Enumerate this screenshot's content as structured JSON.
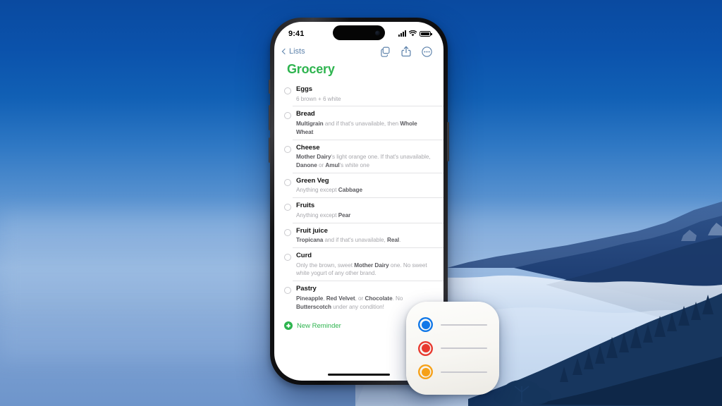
{
  "wallpaper": {
    "description": "Big Sur coastal mountains above a sea of fog, blue sky",
    "sky_top_color": "#0a4da0",
    "sky_bottom_color": "#7ba0d2"
  },
  "phone": {
    "status_bar": {
      "time": "9:41",
      "cellular_icon": "cellular-bars-icon",
      "wifi_icon": "wifi-icon",
      "battery_icon": "battery-full-icon"
    },
    "nav": {
      "back_label": "Lists",
      "back_icon": "chevron-left-icon",
      "icons": [
        {
          "name": "duplicate-icon",
          "label": "Duplicate"
        },
        {
          "name": "share-icon",
          "label": "Share"
        },
        {
          "name": "more-ellipsis-icon",
          "label": "More"
        }
      ]
    },
    "list": {
      "title": "Grocery",
      "title_color": "#2eb44f",
      "items": [
        {
          "title": "Eggs",
          "note_html": "6 brown + 6 white",
          "checkbox": "unchecked"
        },
        {
          "title": "Bread",
          "note_html": "<b>Multigrain</b> and if that's unavailable, then <b>Whole Wheat</b>",
          "checkbox": "unchecked"
        },
        {
          "title": "Cheese",
          "note_html": "<b>Mother Dairy</b>'s light orange one. If that's unavailable, <b>Danone</b> or <b>Amul</b>'s white one",
          "checkbox": "unchecked"
        },
        {
          "title": "Green Veg",
          "note_html": "Anything except <b>Cabbage</b>",
          "checkbox": "unchecked"
        },
        {
          "title": "Fruits",
          "note_html": "Anything except <b>Pear</b>",
          "checkbox": "unchecked"
        },
        {
          "title": "Fruit juice",
          "note_html": "<b>Tropicana</b> and if that's unavailable, <b>Real</b>.",
          "checkbox": "unchecked"
        },
        {
          "title": "Curd",
          "note_html": "Only the brown, sweet <b>Mother Dairy</b> one. No sweet white yogurt of any other brand.",
          "checkbox": "unchecked"
        },
        {
          "title": "Pastry",
          "note_html": "<b>Pineapple</b>, <b>Red Velvet</b>, or <b>Chocolate</b>. No <b>Butterscotch</b> under any condition!",
          "checkbox": "unchecked"
        }
      ],
      "new_reminder_label": "New Reminder",
      "new_reminder_icon": "plus-circle-icon",
      "new_reminder_color": "#2eb44f"
    },
    "home_indicator": "home-indicator-bar"
  },
  "app_icon": {
    "name": "Reminders app icon",
    "rows": [
      {
        "color": "#1077e8",
        "line_color": "#c9c9cf"
      },
      {
        "color": "#e8392f",
        "line_color": "#c9c9cf"
      },
      {
        "color": "#f6a118",
        "line_color": "#c9c9cf"
      }
    ]
  }
}
